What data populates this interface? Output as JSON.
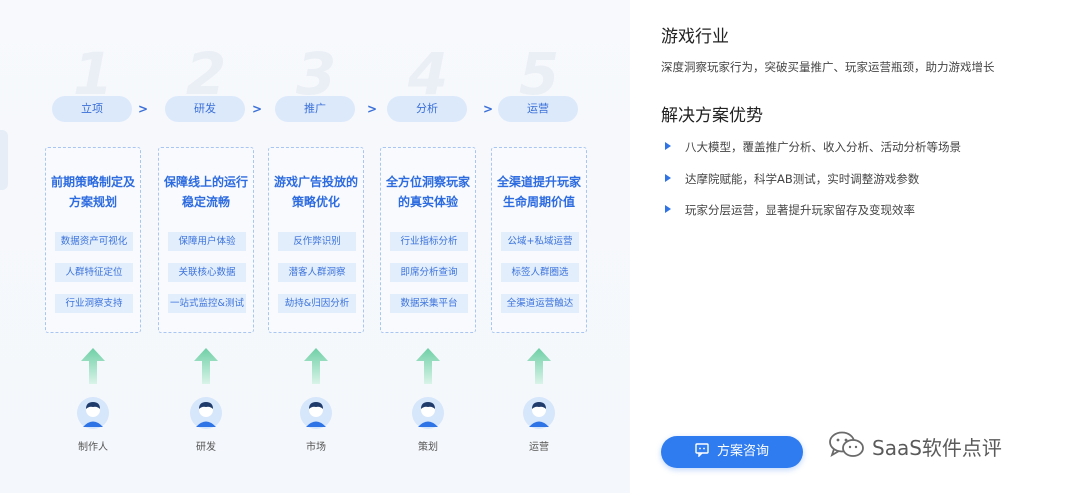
{
  "stages": [
    {
      "num": "1",
      "label": "立项",
      "title": "前期策略制定及方案规划",
      "tags": [
        "数据资产可视化",
        "人群特征定位",
        "行业洞察支持"
      ],
      "role": "制作人"
    },
    {
      "num": "2",
      "label": "研发",
      "title": "保障线上的运行稳定流畅",
      "tags": [
        "保障用户体验",
        "关联核心数据",
        "一站式监控&测试"
      ],
      "role": "研发"
    },
    {
      "num": "3",
      "label": "推广",
      "title": "游戏广告投放的策略优化",
      "tags": [
        "反作弊识别",
        "潜客人群洞察",
        "劫持&归因分析"
      ],
      "role": "市场"
    },
    {
      "num": "4",
      "label": "分析",
      "title": "全方位洞察玩家的真实体验",
      "tags": [
        "行业指标分析",
        "即席分析查询",
        "数据采集平台"
      ],
      "role": "策划"
    },
    {
      "num": "5",
      "label": "运营",
      "title": "全渠道提升玩家生命周期价值",
      "tags": [
        "公域+私域运营",
        "标签人群圈选",
        "全渠道运营触达"
      ],
      "role": "运营"
    }
  ],
  "separator": ">",
  "right": {
    "title": "游戏行业",
    "desc": "深度洞察玩家行为，突破买量推广、玩家运营瓶颈，助力游戏增长",
    "advantage_title": "解决方案优势",
    "bullets": [
      "八大模型，覆盖推广分析、收入分析、活动分析等场景",
      "达摩院赋能，科学AB测试，实时调整游戏参数",
      "玩家分层运营，显著提升玩家留存及变现效率"
    ],
    "consult_label": "方案咨询"
  },
  "watermark": "SaaS软件点评",
  "colors": {
    "accent": "#2f7cf0",
    "pill": "#dce9fb",
    "arrow": "#7ed3b0"
  }
}
